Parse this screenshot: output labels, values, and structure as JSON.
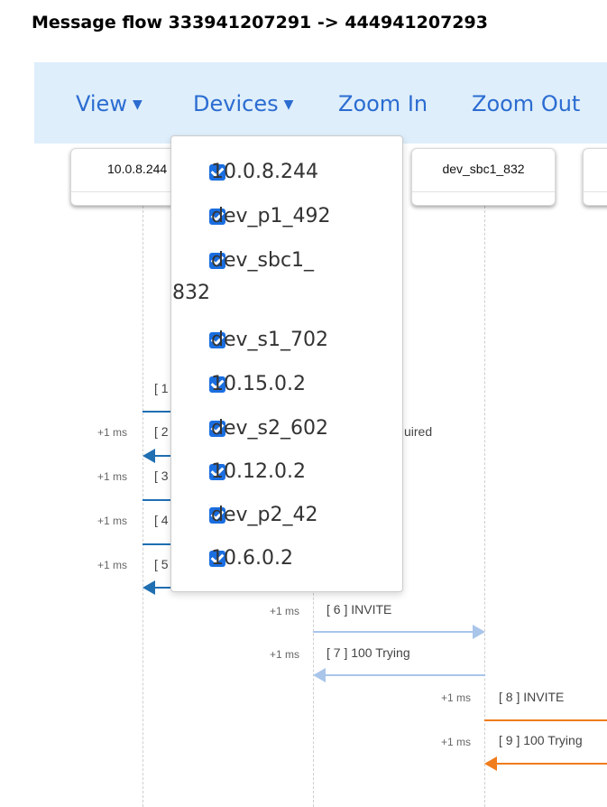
{
  "title": "Message flow 333941207291 -> 444941207293",
  "toolbar": {
    "view_label": "View",
    "devices_label": "Devices",
    "zoom_in_label": "Zoom In",
    "zoom_out_label": "Zoom Out",
    "caret": "▼"
  },
  "device_cards": [
    "10.0.8.244",
    "dev_sbc1_832"
  ],
  "devices_menu": [
    {
      "label": "10.0.8.244",
      "checked": true
    },
    {
      "label": "dev_p1_492",
      "checked": true
    },
    {
      "label": "dev_sbc1_",
      "label_cont": "832",
      "checked": true
    },
    {
      "label": "dev_s1_702",
      "checked": true
    },
    {
      "label": "10.15.0.2",
      "checked": true
    },
    {
      "label": "dev_s2_602",
      "checked": true
    },
    {
      "label": "10.12.0.2",
      "checked": true
    },
    {
      "label": "dev_p2_42",
      "checked": true
    },
    {
      "label": "10.6.0.2",
      "checked": true
    }
  ],
  "messages": [
    {
      "index": 1,
      "delta": "",
      "label": "[ 1"
    },
    {
      "index": 2,
      "delta": "+1 ms",
      "label": "[ 2",
      "label_tail": "uired"
    },
    {
      "index": 3,
      "delta": "+1 ms",
      "label": "[ 3"
    },
    {
      "index": 4,
      "delta": "+1 ms",
      "label": "[ 4"
    },
    {
      "index": 5,
      "delta": "+1 ms",
      "label": "[ 5"
    },
    {
      "index": 6,
      "delta": "+1 ms",
      "label": "[ 6 ] INVITE"
    },
    {
      "index": 7,
      "delta": "+1 ms",
      "label": "[ 7 ] 100 Trying"
    },
    {
      "index": 8,
      "delta": "+1 ms",
      "label": "[ 8 ] INVITE"
    },
    {
      "index": 9,
      "delta": "+1 ms",
      "label": "[ 9 ] 100 Trying"
    }
  ],
  "colors": {
    "accent_blue": "#1f6fb2",
    "light_blue": "#a9c5ea",
    "orange": "#f07c1b",
    "toolbar_bg": "#deeefb",
    "link": "#2b6cd1"
  }
}
